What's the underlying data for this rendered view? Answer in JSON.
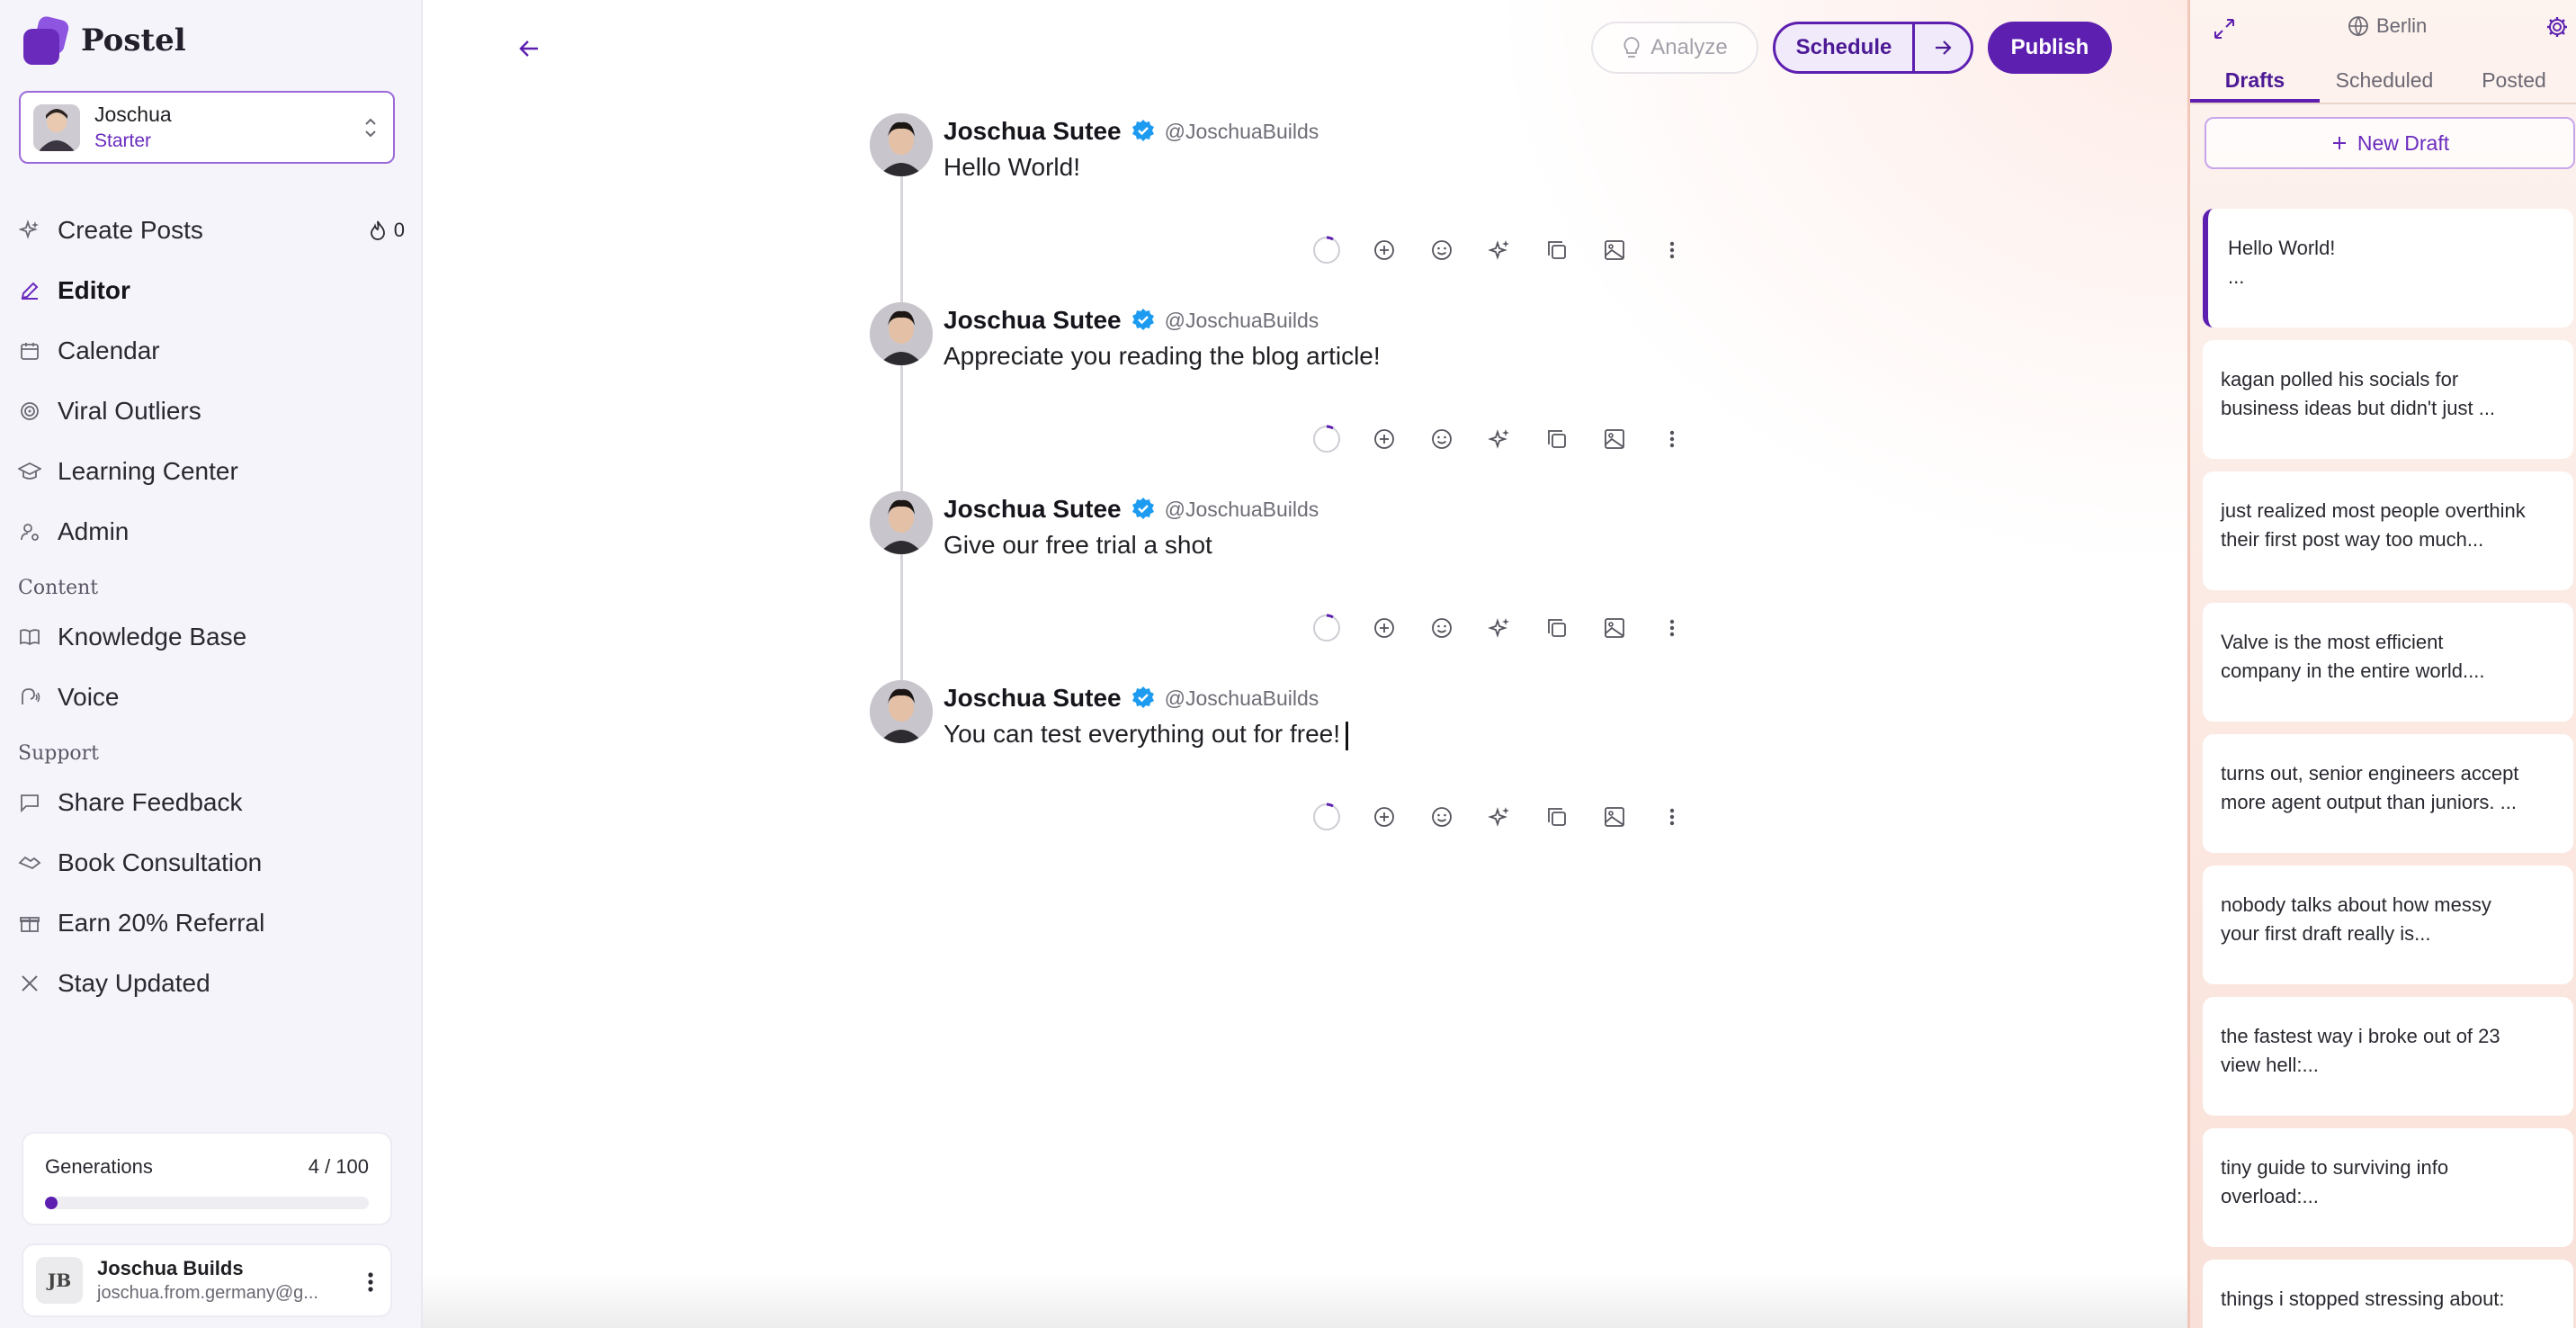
{
  "brand": {
    "name": "Postel"
  },
  "account": {
    "name": "Joschua",
    "plan": "Starter"
  },
  "nav": {
    "items": [
      {
        "label": "Create Posts",
        "count": "0"
      },
      {
        "label": "Editor"
      },
      {
        "label": "Calendar"
      },
      {
        "label": "Viral Outliers"
      },
      {
        "label": "Learning Center"
      },
      {
        "label": "Admin"
      }
    ],
    "content_label": "Content",
    "content_items": [
      {
        "label": "Knowledge Base"
      },
      {
        "label": "Voice"
      }
    ],
    "support_label": "Support",
    "support_items": [
      {
        "label": "Share Feedback"
      },
      {
        "label": "Book Consultation"
      },
      {
        "label": "Earn 20% Referral"
      },
      {
        "label": "Stay Updated"
      }
    ]
  },
  "generations": {
    "label": "Generations",
    "value": "4 / 100",
    "used": 4,
    "total": 100
  },
  "user": {
    "initials": "JB",
    "name": "Joschua Builds",
    "email": "joschua.from.germany@g..."
  },
  "toolbar": {
    "analyze_label": "Analyze",
    "schedule_label": "Schedule",
    "publish_label": "Publish"
  },
  "thread": {
    "author_name": "Joschua Sutee",
    "author_handle": "@JoschuaBuilds",
    "posts": [
      {
        "text": "Hello World!"
      },
      {
        "text": "Appreciate you reading the blog article!"
      },
      {
        "text": "Give our free trial a shot"
      },
      {
        "text": "You can test everything out for free!"
      }
    ]
  },
  "right_panel": {
    "timezone": "Berlin",
    "tabs": [
      "Drafts",
      "Scheduled",
      "Posted"
    ],
    "active_tab": "Drafts",
    "new_draft_label": "New Draft",
    "drafts": [
      {
        "line1": "Hello World!",
        "line2": "..."
      },
      {
        "line1": "kagan polled his socials for",
        "line2": "business ideas but didn't just ..."
      },
      {
        "line1": "just realized most people overthink",
        "line2": "their first post way too much..."
      },
      {
        "line1": "Valve is the most efficient",
        "line2": "company in the entire world...."
      },
      {
        "line1": "turns out, senior engineers accept",
        "line2": "more agent output than juniors. ..."
      },
      {
        "line1": "nobody talks about how messy",
        "line2": "your first draft really is..."
      },
      {
        "line1": "the fastest way i broke out of 23",
        "line2": "view hell:..."
      },
      {
        "line1": "tiny guide to surviving info",
        "line2": "overload:..."
      },
      {
        "line1": "things i stopped stressing about:",
        "line2": ""
      }
    ]
  },
  "colors": {
    "accent": "#5d1fb0",
    "verified": "#1d9bf0"
  }
}
